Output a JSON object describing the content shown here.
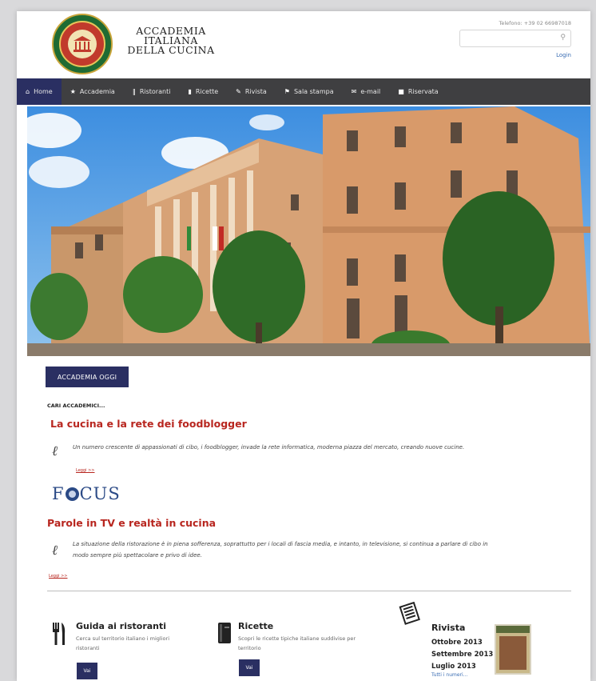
{
  "header": {
    "brand_line1": "ACCADEMIA",
    "brand_line2": "ITALIANA",
    "brand_line3": "DELLA CUCINA",
    "phone": "Telefono: +39 02 66987018",
    "search_placeholder": "",
    "login_label": "Login"
  },
  "nav": [
    {
      "label": "Home",
      "icon": "home-icon"
    },
    {
      "label": "Accademia",
      "icon": "star-icon"
    },
    {
      "label": "Ristoranti",
      "icon": "cutlery-icon"
    },
    {
      "label": "Ricette",
      "icon": "book-icon"
    },
    {
      "label": "Rivista",
      "icon": "pen-icon"
    },
    {
      "label": "Sala stampa",
      "icon": "flag-icon"
    },
    {
      "label": "e-mail",
      "icon": "envelope-icon"
    },
    {
      "label": "Riservata",
      "icon": "lock-icon"
    }
  ],
  "section": {
    "tag": "ACCADEMIA OGGI",
    "dear": "CARI ACCADEMICI...",
    "article1_title": "La cucina e la rete dei foodblogger",
    "article1_text": "Un numero crescente di appassionati di cibo, i foodblogger, invade la rete informatica, moderna piazza del mercato, creando nuove cucine.",
    "more_label": "Leggi >>",
    "focus_logo": "FOCUS",
    "article2_title": "Parole in TV e realtà in cucina",
    "article2_text_line1": "La situazione della ristorazione è in piena sofferenza, soprattutto per i locali di fascia media, e intanto, in televisione, si continua a parlare di cibo in",
    "article2_text_line2": "modo sempre più spettacolare e privo di idee."
  },
  "boxes": {
    "restaurants": {
      "title": "Guida ai ristoranti",
      "text_line1": "Cerca sul territorio italiano i migliori",
      "text_line2": "ristoranti",
      "button": "Vai",
      "icon": "cutlery-icon"
    },
    "recipes": {
      "title": "Ricette",
      "text_line1": "Scopri le ricette tipiche italiane suddivise per",
      "text_line2": "territorio",
      "button": "Vai",
      "icon": "book-icon"
    },
    "magazine": {
      "title": "Rivista",
      "issues": [
        "Ottobre 2013",
        "Settembre 2013",
        "Luglio 2013"
      ],
      "link": "Tutti i numeri...",
      "icon": "magazine-icon"
    }
  },
  "colors": {
    "nav_bg": "#3f3f41",
    "accent": "#2a2f62",
    "title_red": "#b8261f",
    "link_blue": "#3a6db3"
  }
}
